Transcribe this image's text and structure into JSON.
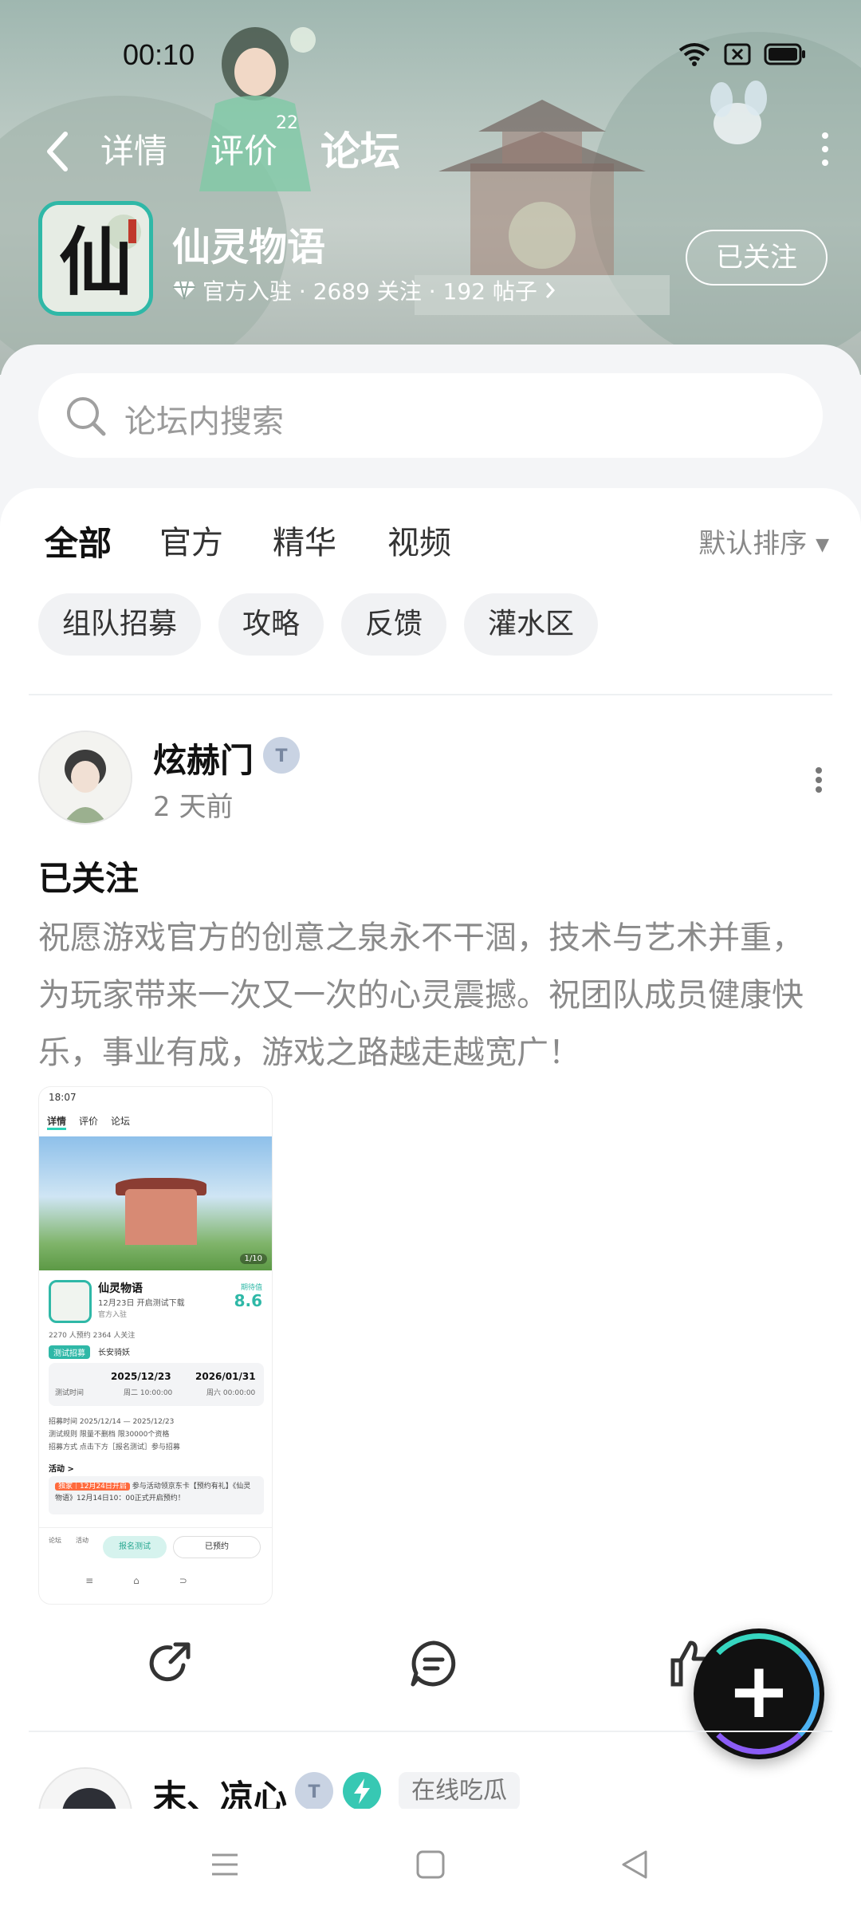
{
  "status_bar": {
    "time": "00:10"
  },
  "nav": {
    "tabs": [
      {
        "label": "详情"
      },
      {
        "label": "评价",
        "badge": "22"
      },
      {
        "label": "论坛"
      }
    ]
  },
  "game": {
    "name": "仙灵物语",
    "meta": "官方入驻 · 2689 关注 · 192 帖子",
    "follow_label": "已关注",
    "icon_char": "仙"
  },
  "search": {
    "placeholder": "论坛内搜索"
  },
  "filter_tabs": [
    "全部",
    "官方",
    "精华",
    "视频"
  ],
  "sort_label": "默认排序",
  "chips": [
    "组队招募",
    "攻略",
    "反馈",
    "灌水区"
  ],
  "post": {
    "user": "炫赫门",
    "time": "2 天前",
    "title": "已关注",
    "body": "祝愿游戏官方的创意之泉永不干涸，技术与艺术并重，为玩家带来一次又一次的心灵震撼。祝团队成员健康快乐，事业有成，游戏之路越走越宽广！"
  },
  "thumbnail": {
    "status_time": "18:07",
    "tabs": [
      "详情",
      "评价",
      "论坛"
    ],
    "page_indicator": "1/10",
    "game_name": "仙灵物语",
    "date_line": "12月23日 开启测试下载",
    "official": "官方入驻",
    "score_label": "期待值",
    "score": "8.6",
    "counts": "2270 人预约   2364 人关注",
    "test_tag": "测试招募",
    "test_name": "长安骑妖",
    "test_time_label": "测试时间",
    "start_date": "2025/12/23",
    "start_time": "周二 10:00:00",
    "end_date": "2026/01/31",
    "end_time": "周六 00:00:00",
    "rows": [
      "招募时间     2025/12/14 — 2025/12/23",
      "测试规则     限量不删档 限30000个资格",
      "招募方式     点击下方［报名测试］参与招募"
    ],
    "activity_label": "活动 >",
    "event_hot": "独家｜12月24日开启",
    "event_text": "参与活动领京东卡【预约有礼】《仙灵物语》12月14日10：00正式开启预约！",
    "bottom_small_1": "论坛",
    "bottom_small_2": "活动",
    "signup_label": "报名测试",
    "reserved_label": "已预约"
  },
  "next_post": {
    "user": "末、凉心",
    "tag": "在线吃瓜"
  },
  "colors": {
    "accent": "#2ad1b7",
    "text_primary": "#111111",
    "text_secondary": "#8a8a8a"
  }
}
